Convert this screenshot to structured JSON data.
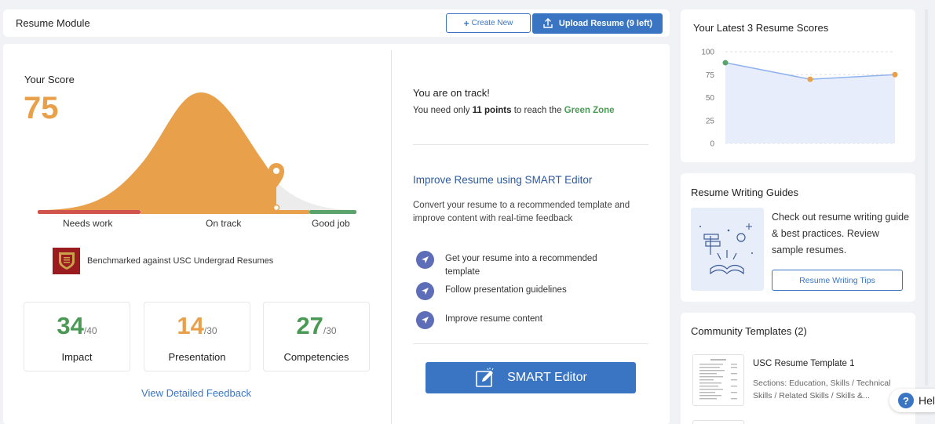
{
  "header": {
    "title": "Resume Module",
    "create_new_label": "Create New",
    "upload_label": "Upload Resume (9 left)"
  },
  "score": {
    "label": "Your Score",
    "value": "75",
    "scale_labels": [
      "Needs work",
      "On track",
      "Good job"
    ],
    "percentile_fraction": 0.75,
    "benchmark_text": "Benchmarked against USC Undergrad Resumes"
  },
  "metrics": [
    {
      "value": "34",
      "max": "/40",
      "label": "Impact",
      "color": "#4a9a55"
    },
    {
      "value": "14",
      "max": "/30",
      "label": "Presentation",
      "color": "#e9a04a"
    },
    {
      "value": "27",
      "max": "/30",
      "label": "Competencies",
      "color": "#4a9a55"
    }
  ],
  "feedback_link": "View Detailed Feedback",
  "status": {
    "title": "You are on track!",
    "sub_prefix": "You need only ",
    "sub_points": "11 points",
    "sub_middle": " to reach the ",
    "sub_zone": "Green Zone"
  },
  "smart": {
    "title": "Improve Resume using SMART Editor",
    "description": "Convert your resume to a recommended template and improve content with real-time feedback",
    "steps": [
      "Get your resume into a recommended template",
      "Follow presentation guidelines",
      "Improve resume content"
    ],
    "button_label": "SMART Editor"
  },
  "scores_card": {
    "title": "Your Latest 3 Resume Scores"
  },
  "chart_data": {
    "type": "area",
    "title": "Your Latest 3 Resume Scores",
    "x": [
      1,
      2,
      3
    ],
    "values": [
      88,
      70,
      75
    ],
    "point_colors": [
      "#5aa46a",
      "#e9a04a",
      "#e9a04a"
    ],
    "yticks": [
      "100",
      "75",
      "50",
      "25",
      "0"
    ],
    "ylim": [
      0,
      100
    ],
    "grid": true
  },
  "guides": {
    "title": "Resume Writing Guides",
    "text": "Check out resume writing guide & best practices. Review sample resumes.",
    "button_label": "Resume Writing Tips"
  },
  "community": {
    "title": "Community Templates (2)",
    "template_name": "USC Resume Template 1",
    "template_desc": "Sections: Education, Skills / Technical Skills / Related Skills / Skills &..."
  },
  "help": {
    "label": "Hel"
  },
  "colors": {
    "accent": "#3a75c4",
    "orange": "#e9a04a",
    "green": "#4a9a55",
    "red": "#d0534c"
  }
}
